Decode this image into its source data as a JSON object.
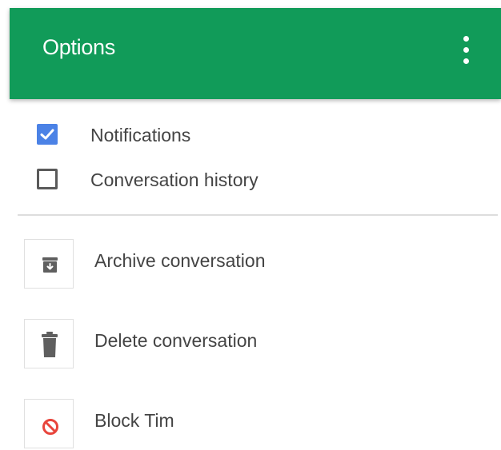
{
  "header": {
    "title": "Options",
    "more_icon": "more-vertical-icon",
    "background_color": "#119b59"
  },
  "options": {
    "notifications": {
      "label": "Notifications",
      "checked": true,
      "icon": "checkbox-checked-icon"
    },
    "history": {
      "label": "Conversation history",
      "checked": false,
      "icon": "checkbox-unchecked-icon"
    }
  },
  "actions": {
    "archive": {
      "label": "Archive conversation",
      "icon": "archive-icon"
    },
    "delete": {
      "label": "Delete conversation",
      "icon": "trash-icon"
    },
    "block": {
      "label": "Block Tim",
      "icon": "block-icon",
      "icon_color": "#e8453c"
    }
  },
  "colors": {
    "checkbox_checked": "#4b82e6",
    "text": "#444444"
  }
}
